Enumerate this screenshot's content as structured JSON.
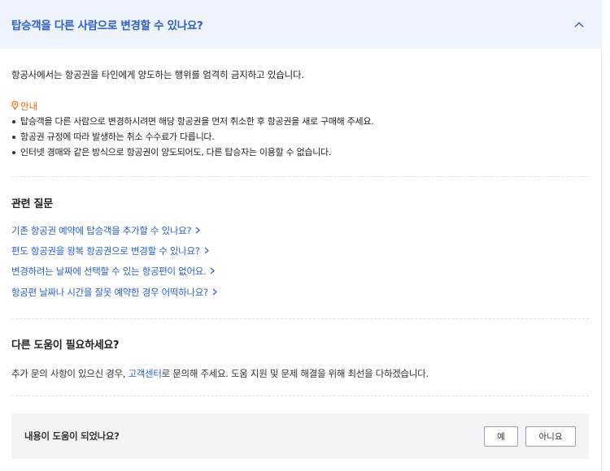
{
  "faq": {
    "title": "탑승객을 다른 사람으로 변경할 수 있나요?",
    "intro": "항공사에서는 항공권을 타인에게 양도하는 행위를 엄격히 금지하고 있습니다.",
    "notice": {
      "label": "안내",
      "items": [
        "탑승객을 다른 사람으로 변경하시려면 해당 항공권을 먼저 취소한 후 항공권을 새로 구매해 주세요.",
        "항공권 규정에 따라 발생하는 취소 수수료가 다릅니다.",
        "인터넷 경매와 같은 방식으로 항공권이 양도되어도, 다른 탑승자는 이용할 수 없습니다."
      ]
    }
  },
  "related": {
    "title": "관련 질문",
    "links": [
      "기존 항공권 예약에 탑승객을 추가할 수 있나요?",
      "편도 항공권을 왕복 항공권으로 변경할 수 있나요?",
      "변경하려는 날짜에 선택할 수 있는 항공편이 없어요.",
      "항공편 날짜나 시간을 잘못 예약한 경우 어떡하나요?"
    ]
  },
  "help": {
    "title": "다른 도움이 필요하세요?",
    "text_before": "추가 문의 사항이 있으신 경우, ",
    "link": "고객센터",
    "text_after": "로 문의해 주세요. 도움 지원 및 문제 해결을 위해 최선을 다하겠습니다."
  },
  "feedback": {
    "question": "내용이 도움이 되었나요?",
    "yes": "예",
    "no": "아니요"
  },
  "colors": {
    "accent": "#2a5fcb",
    "notice": "#f06b0a",
    "header_bg": "#eef3fc",
    "feedback_bg": "#f2f4f7"
  },
  "icons": {
    "collapse": "chevron-up-icon",
    "notice": "location-pin-icon",
    "link_arrow": "chevron-right-icon"
  }
}
